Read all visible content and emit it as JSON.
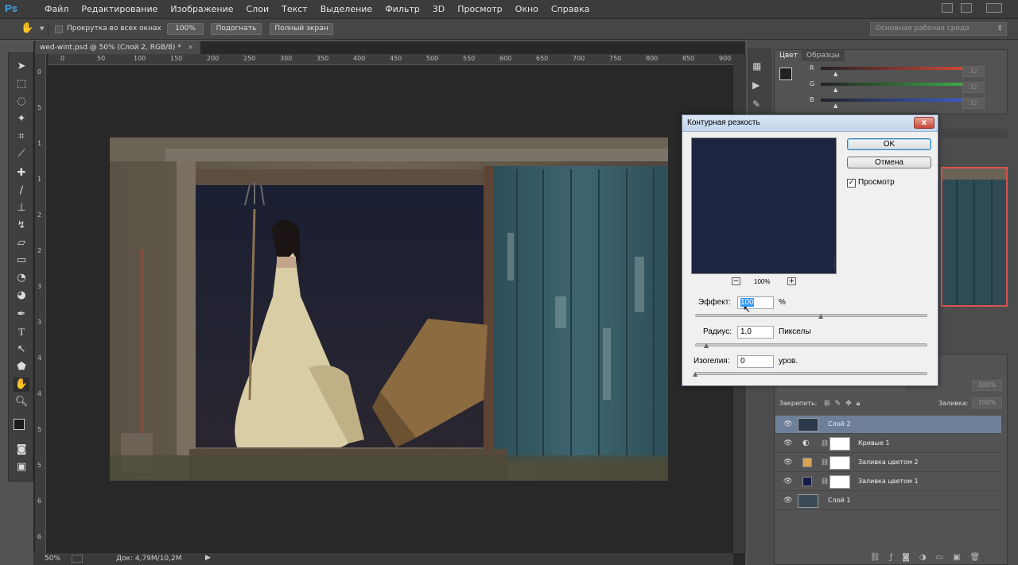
{
  "menubar": {
    "logo": "Ps",
    "items": [
      "Файл",
      "Редактирование",
      "Изображение",
      "Слои",
      "Текст",
      "Выделение",
      "Фильтр",
      "3D",
      "Просмотр",
      "Окно",
      "Справка"
    ]
  },
  "options": {
    "scroll_all_label": "Прокрутка во всех окнах",
    "zoom_100": "100%",
    "fit_label": "Подогнать",
    "fullscreen_label": "Полный экран",
    "workspace": "Основная рабочая среда"
  },
  "document": {
    "tab_title": "wed-wint.psd @ 50% (Слой 2, RGB/8) *",
    "close": "×",
    "zoom": "50%",
    "doc_info": "Док: 4,79M/10,2M",
    "ruler_top_numbers": [
      "0",
      "50",
      "100",
      "150",
      "200",
      "250",
      "300",
      "350",
      "400",
      "450",
      "500",
      "550",
      "600",
      "650",
      "700",
      "750",
      "800",
      "850",
      "900"
    ],
    "ruler_left_numbers": [
      "0",
      "5",
      "1",
      "1",
      "2",
      "2",
      "3",
      "3",
      "4",
      "4",
      "5",
      "5",
      "6",
      "6"
    ]
  },
  "color_panel": {
    "tabs": [
      "Цвет",
      "Образцы"
    ],
    "channels": [
      {
        "label": "R",
        "value": "32",
        "color": "#d94a3a"
      },
      {
        "label": "G",
        "value": "32",
        "color": "#3fb34a"
      },
      {
        "label": "B",
        "value": "32",
        "color": "#3a5fd9"
      }
    ]
  },
  "layers_panel": {
    "lock_label": "Закрепить:",
    "fill_label": "Заливка:",
    "fill_value": "100%",
    "opacity_value": "100%",
    "layers": [
      {
        "name": "Слой 2",
        "selected": true,
        "thumb": "#2b3a4a",
        "mask": false
      },
      {
        "name": "Кривые 1",
        "selected": false,
        "thumb": "#ffffff",
        "mask": true
      },
      {
        "name": "Заливка цветом 2",
        "selected": false,
        "thumb": "#d8a35a",
        "mask": true
      },
      {
        "name": "Заливка цветом 1",
        "selected": false,
        "thumb": "#141c4a",
        "mask": true
      },
      {
        "name": "Слой 1",
        "selected": false,
        "thumb": "#3a4a55",
        "mask": false
      }
    ]
  },
  "dialog": {
    "title": "Контурная резкость",
    "close": "x",
    "ok_label": "OK",
    "cancel_label": "Отмена",
    "preview_label": "Просмотр",
    "preview_checked": true,
    "zoom_value": "100%",
    "zoom_minus": "−",
    "zoom_plus": "+",
    "amount_label": "Эффект:",
    "amount_value": "100",
    "amount_unit": "%",
    "radius_label": "Радиус:",
    "radius_value": "1,0",
    "radius_unit": "Пикселы",
    "threshold_label": "Изогелия:",
    "threshold_value": "0",
    "threshold_unit": "уров."
  }
}
